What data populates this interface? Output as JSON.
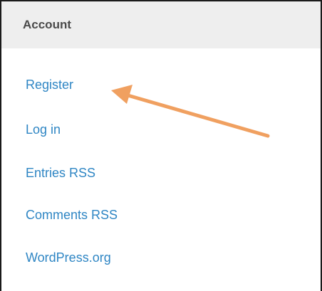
{
  "widget": {
    "title": "Account",
    "links": [
      {
        "label": "Register"
      },
      {
        "label": "Log in"
      },
      {
        "label": "Entries RSS"
      },
      {
        "label": "Comments RSS"
      },
      {
        "label": "WordPress.org"
      }
    ]
  },
  "annotation": {
    "type": "arrow",
    "color": "#f0a060",
    "points_to": "Register"
  }
}
